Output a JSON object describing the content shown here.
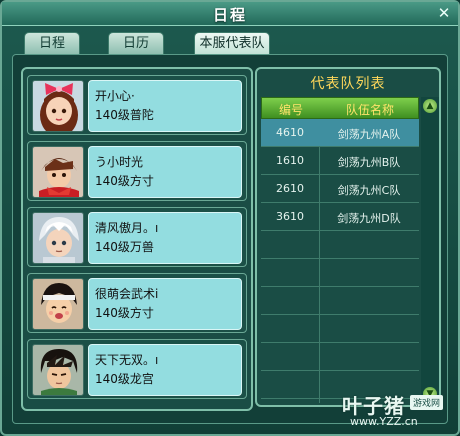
{
  "window": {
    "title": "日程",
    "close_glyph": "✕"
  },
  "tabs": [
    {
      "label": "日程",
      "active": false
    },
    {
      "label": "日历",
      "active": false
    },
    {
      "label": "本服代表队",
      "active": true
    }
  ],
  "members": [
    {
      "name": "开小心·",
      "level": "140级普陀",
      "icon": "girl-bow-avatar-icon"
    },
    {
      "name": "う小时光",
      "level": "140级方寸",
      "icon": "boy-red-scarf-avatar-icon"
    },
    {
      "name": "清风傲月。ı",
      "level": "140级万兽",
      "icon": "white-hair-avatar-icon"
    },
    {
      "name": "很萌会武术i",
      "level": "140级方寸",
      "icon": "headband-boy-avatar-icon"
    },
    {
      "name": "天下无双。ı",
      "level": "140级龙宫",
      "icon": "dark-hair-boy-avatar-icon"
    }
  ],
  "team_list": {
    "title": "代表队列表",
    "headers": [
      "编号",
      "队伍名称"
    ],
    "rows": [
      {
        "id": "4610",
        "name": "剑荡九州A队",
        "selected": true
      },
      {
        "id": "1610",
        "name": "剑荡九州B队",
        "selected": false
      },
      {
        "id": "2610",
        "name": "剑荡九州C队",
        "selected": false
      },
      {
        "id": "3610",
        "name": "剑荡九州D队",
        "selected": false
      }
    ]
  },
  "watermark": {
    "main": "叶子猪",
    "badge": "游戏网",
    "url": "www.YZZ.cn"
  },
  "colors": {
    "accent_yellow": "#ffd85a",
    "header_green": "#5fb03a",
    "selected_row": "#3f8fa0",
    "info_cyan": "#93dde0"
  }
}
